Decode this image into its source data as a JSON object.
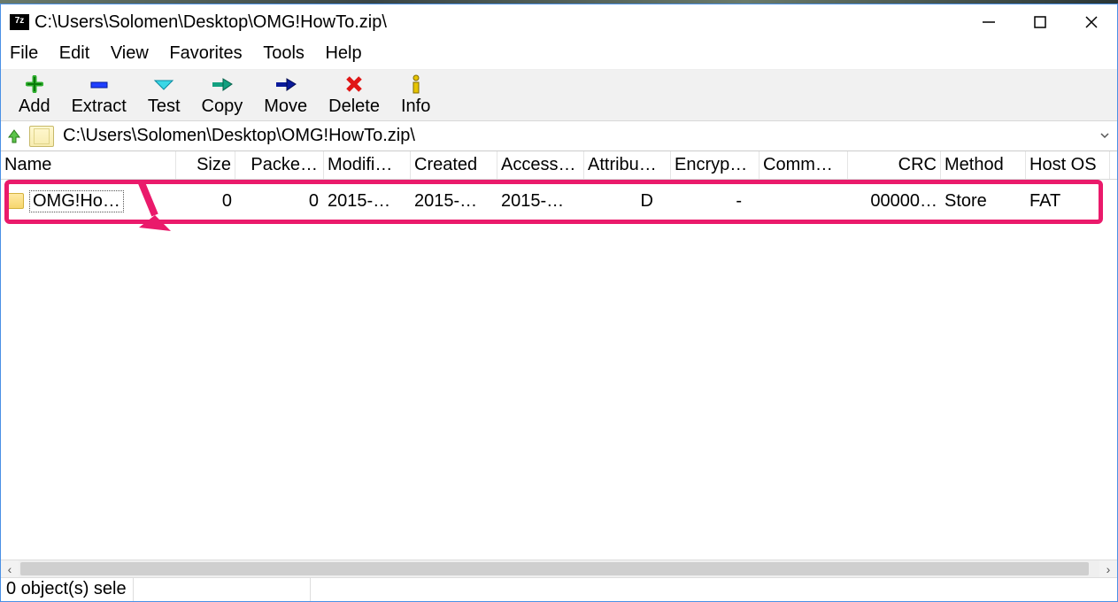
{
  "title": "C:\\Users\\Solomen\\Desktop\\OMG!HowTo.zip\\",
  "app_icon_label": "7z",
  "menu": {
    "file": "File",
    "edit": "Edit",
    "view": "View",
    "favorites": "Favorites",
    "tools": "Tools",
    "help": "Help"
  },
  "toolbar": {
    "add": "Add",
    "extract": "Extract",
    "test": "Test",
    "copy": "Copy",
    "move": "Move",
    "delete": "Delete",
    "info": "Info"
  },
  "address": "C:\\Users\\Solomen\\Desktop\\OMG!HowTo.zip\\",
  "columns": {
    "name": "Name",
    "size": "Size",
    "packed": "Packe…",
    "modified": "Modifi…",
    "created": "Created",
    "accessed": "Access…",
    "attrib": "Attribu…",
    "encryp": "Encryp…",
    "comment": "Comm…",
    "crc": "CRC",
    "method": "Method",
    "hostos": "Host OS"
  },
  "rows": [
    {
      "name": "OMG!Ho…",
      "size": "0",
      "packed": "0",
      "modified": "2015-…",
      "created": "2015-…",
      "accessed": "2015-…",
      "attrib": "D",
      "encryp": "-",
      "comment": "",
      "crc": "00000…",
      "method": "Store",
      "hostos": "FAT"
    }
  ],
  "status": "0 object(s) sele",
  "icons": {
    "add": "plus-icon",
    "extract": "minus-icon",
    "test": "check-icon",
    "copy": "arrow-right-icon",
    "move": "arrow-right-bold-icon",
    "delete": "cross-icon",
    "info": "info-icon",
    "up": "up-folder-icon",
    "dropdown": "chevron-down-icon",
    "min": "minimize-icon",
    "max": "maximize-icon",
    "close": "close-icon"
  },
  "colors": {
    "highlight": "#ea1a6b",
    "window_border": "#4a90e5"
  }
}
